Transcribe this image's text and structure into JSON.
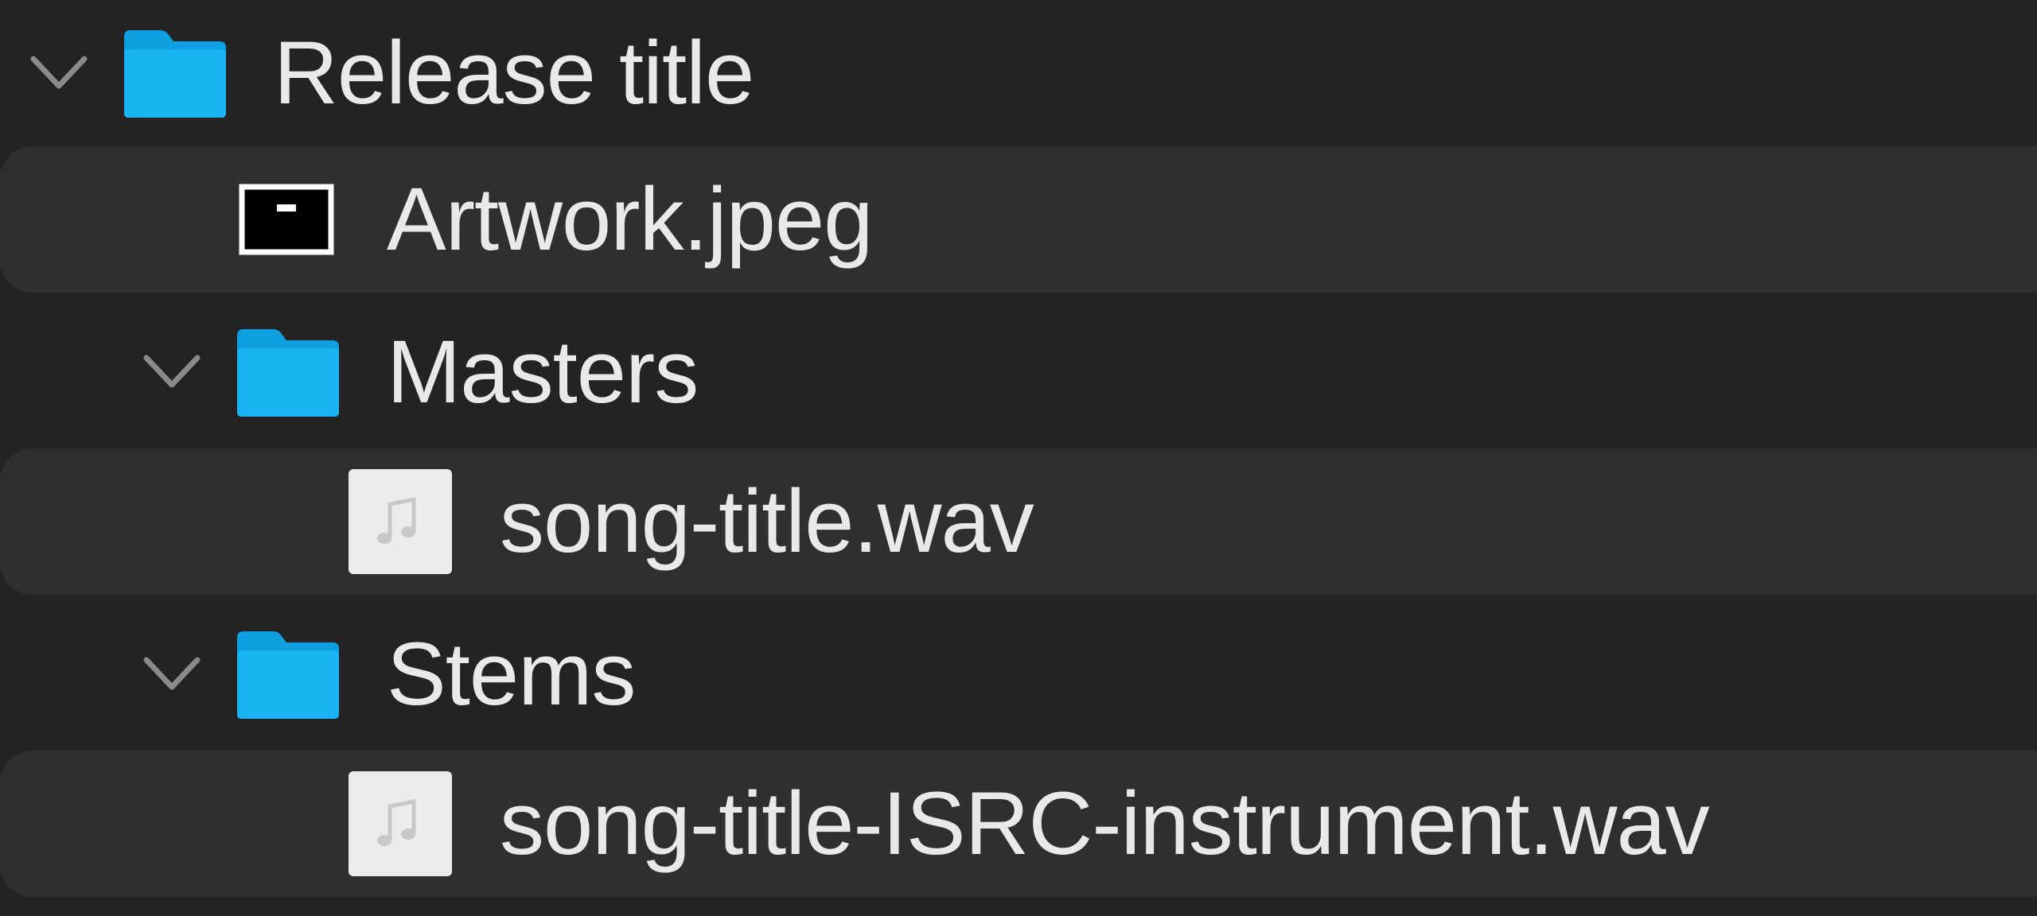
{
  "tree": {
    "items": [
      {
        "label": "Release title",
        "kind": "folder",
        "expanded": true,
        "icon": "folder-icon"
      },
      {
        "label": "Artwork.jpeg",
        "kind": "image-file",
        "icon": "image-file-icon"
      },
      {
        "label": "Masters",
        "kind": "folder",
        "expanded": true,
        "icon": "folder-icon"
      },
      {
        "label": "song-title.wav",
        "kind": "audio-file",
        "icon": "audio-file-icon"
      },
      {
        "label": "Stems",
        "kind": "folder",
        "expanded": true,
        "icon": "folder-icon"
      },
      {
        "label": "song-title-ISRC-instrument.wav",
        "kind": "audio-file",
        "icon": "audio-file-icon"
      }
    ]
  },
  "colors": {
    "background": "#232323",
    "alternate_row": "#2f2f2f",
    "folder_blue": "#1ab4f2",
    "text": "#e9e9e9"
  }
}
